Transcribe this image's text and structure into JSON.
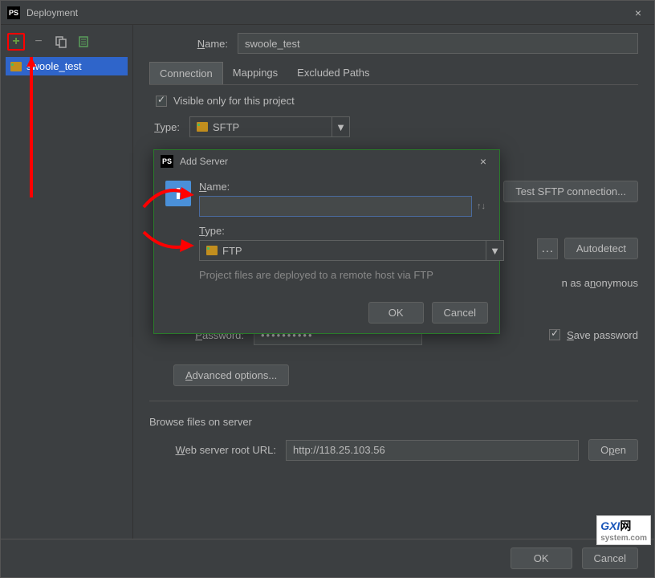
{
  "window": {
    "title": "Deployment"
  },
  "sidebar": {
    "items": [
      {
        "label": "swoole_test"
      }
    ]
  },
  "main": {
    "name_label": "Name:",
    "name_value": "swoole_test",
    "tabs": [
      "Connection",
      "Mappings",
      "Excluded Paths"
    ],
    "visible_project_label": "Visible only for this project",
    "type_label": "Type:",
    "type_value": "SFTP",
    "test_btn": "Test SFTP connection...",
    "autodetect_btn": "Autodetect",
    "anonymous_label": "n as anonymous",
    "ellipsis": "…",
    "password_label": "Password:",
    "password_value": "••••••••••",
    "save_password_label": "Save password",
    "advanced_btn": "Advanced options...",
    "browse_section": "Browse files on server",
    "web_root_label": "Web server root URL:",
    "web_root_value": "http://118.25.103.56",
    "open_btn": "Open",
    "ok_btn": "OK",
    "cancel_btn": "Cancel"
  },
  "modal": {
    "title": "Add Server",
    "name_label": "Name:",
    "name_value": "",
    "type_label": "Type:",
    "type_value": "FTP",
    "hint": "Project files are deployed to a remote host via FTP",
    "ok_btn": "OK",
    "cancel_btn": "Cancel"
  },
  "watermark": {
    "main": "GXI",
    "suffix": "网",
    "sub": "system.com"
  }
}
